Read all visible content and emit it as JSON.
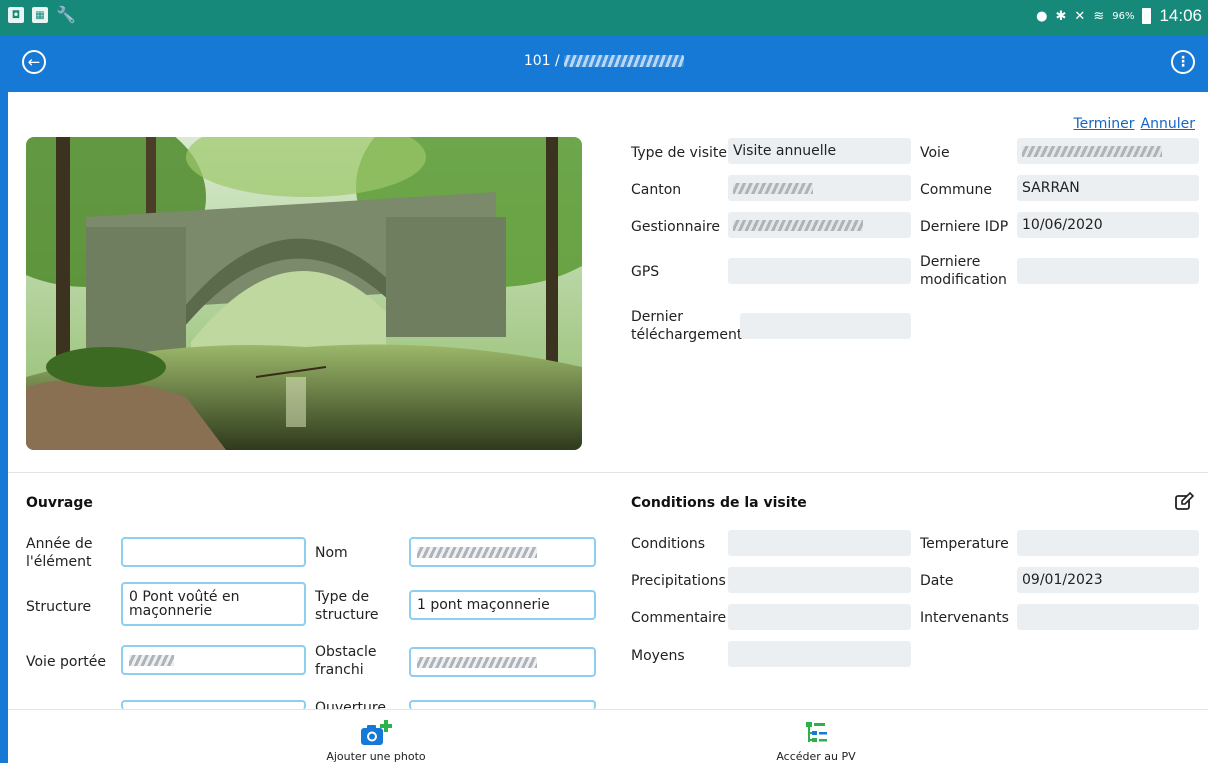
{
  "status_bar": {
    "battery_text": "96%",
    "time": "14:06"
  },
  "app_bar": {
    "title_prefix": "101 /"
  },
  "actions": {
    "finish": "Terminer",
    "cancel": "Annuler"
  },
  "details": {
    "type_visite_label": "Type de visite",
    "type_visite_value": "Visite annuelle",
    "voie_label": "Voie",
    "canton_label": "Canton",
    "commune_label": "Commune",
    "commune_value": "SARRAN",
    "gestionnaire_label": "Gestionnaire",
    "derniere_idp_label": "Derniere IDP",
    "derniere_idp_value": "10/06/2020",
    "gps_label": "GPS",
    "derniere_modif_label_1": "Derniere",
    "derniere_modif_label_2": "modification",
    "dernier_telech_label_1": "Dernier",
    "dernier_telech_label_2": "téléchargement"
  },
  "ouvrage": {
    "title": "Ouvrage",
    "annee_label_1": "Année de",
    "annee_label_2": "l'élément",
    "nom_label": "Nom",
    "structure_label": "Structure",
    "structure_value_1": "0 Pont voûté en",
    "structure_value_2": "maçonnerie",
    "type_structure_label_1": "Type de",
    "type_structure_label_2": "structure",
    "type_structure_value": "1 pont maçonnerie",
    "voie_portee_label": "Voie portée",
    "obstacle_label_1": "Obstacle",
    "obstacle_label_2": "franchi",
    "ouverture_label": "Ouverture"
  },
  "conditions": {
    "title": "Conditions de la visite",
    "conditions_label": "Conditions",
    "temperature_label": "Temperature",
    "precipitations_label": "Precipitations",
    "date_label": "Date",
    "date_value": "09/01/2023",
    "commentaire_label": "Commentaire",
    "intervenants_label": "Intervenants",
    "moyens_label": "Moyens"
  },
  "bottom_bar": {
    "add_photo": "Ajouter une photo",
    "access_pv": "Accéder au PV"
  },
  "colors": {
    "status_bar": "#17897a",
    "app_bar": "#1679d6",
    "link": "#1467c5",
    "input_border": "#8ccfee",
    "field_bg": "#eceff1"
  }
}
